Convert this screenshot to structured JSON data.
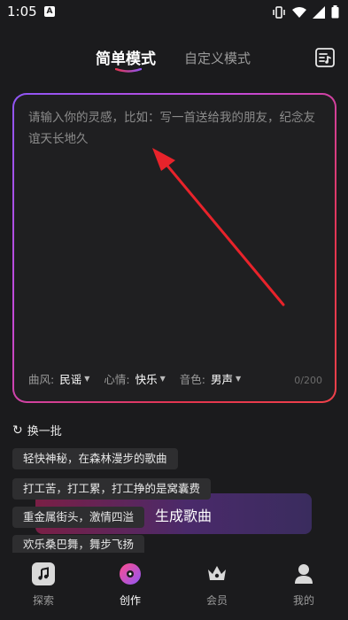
{
  "status": {
    "time": "1:05",
    "app_badge": "A"
  },
  "header": {
    "tab_simple": "简单模式",
    "tab_custom": "自定义模式",
    "menu_icon": "playlist-icon"
  },
  "input": {
    "placeholder": "请输入你的灵感，比如：写一首送给我的朋友，纪念友谊天长地久",
    "value": "",
    "counter": "0/200"
  },
  "options": [
    {
      "label": "曲风:",
      "value": "民谣"
    },
    {
      "label": "心情:",
      "value": "快乐"
    },
    {
      "label": "音色:",
      "value": "男声"
    }
  ],
  "refresh_label": "换一批",
  "suggestions": [
    "轻快神秘，在森林漫步的歌曲",
    "打工苦，打工累，打工挣的是窝囊费",
    "重金属街头，激情四溢",
    "欢乐桑巴舞，舞步飞扬"
  ],
  "generate_label": "生成歌曲",
  "nav": [
    {
      "label": "探索",
      "icon": "music-note-icon"
    },
    {
      "label": "创作",
      "icon": "disc-icon"
    },
    {
      "label": "会员",
      "icon": "crown-icon"
    },
    {
      "label": "我的",
      "icon": "user-icon"
    }
  ],
  "colors": {
    "background": "#1b1b1d",
    "accent_purple": "#8f56f5",
    "accent_red": "#e4354f",
    "arrow_red": "#e8232b"
  }
}
